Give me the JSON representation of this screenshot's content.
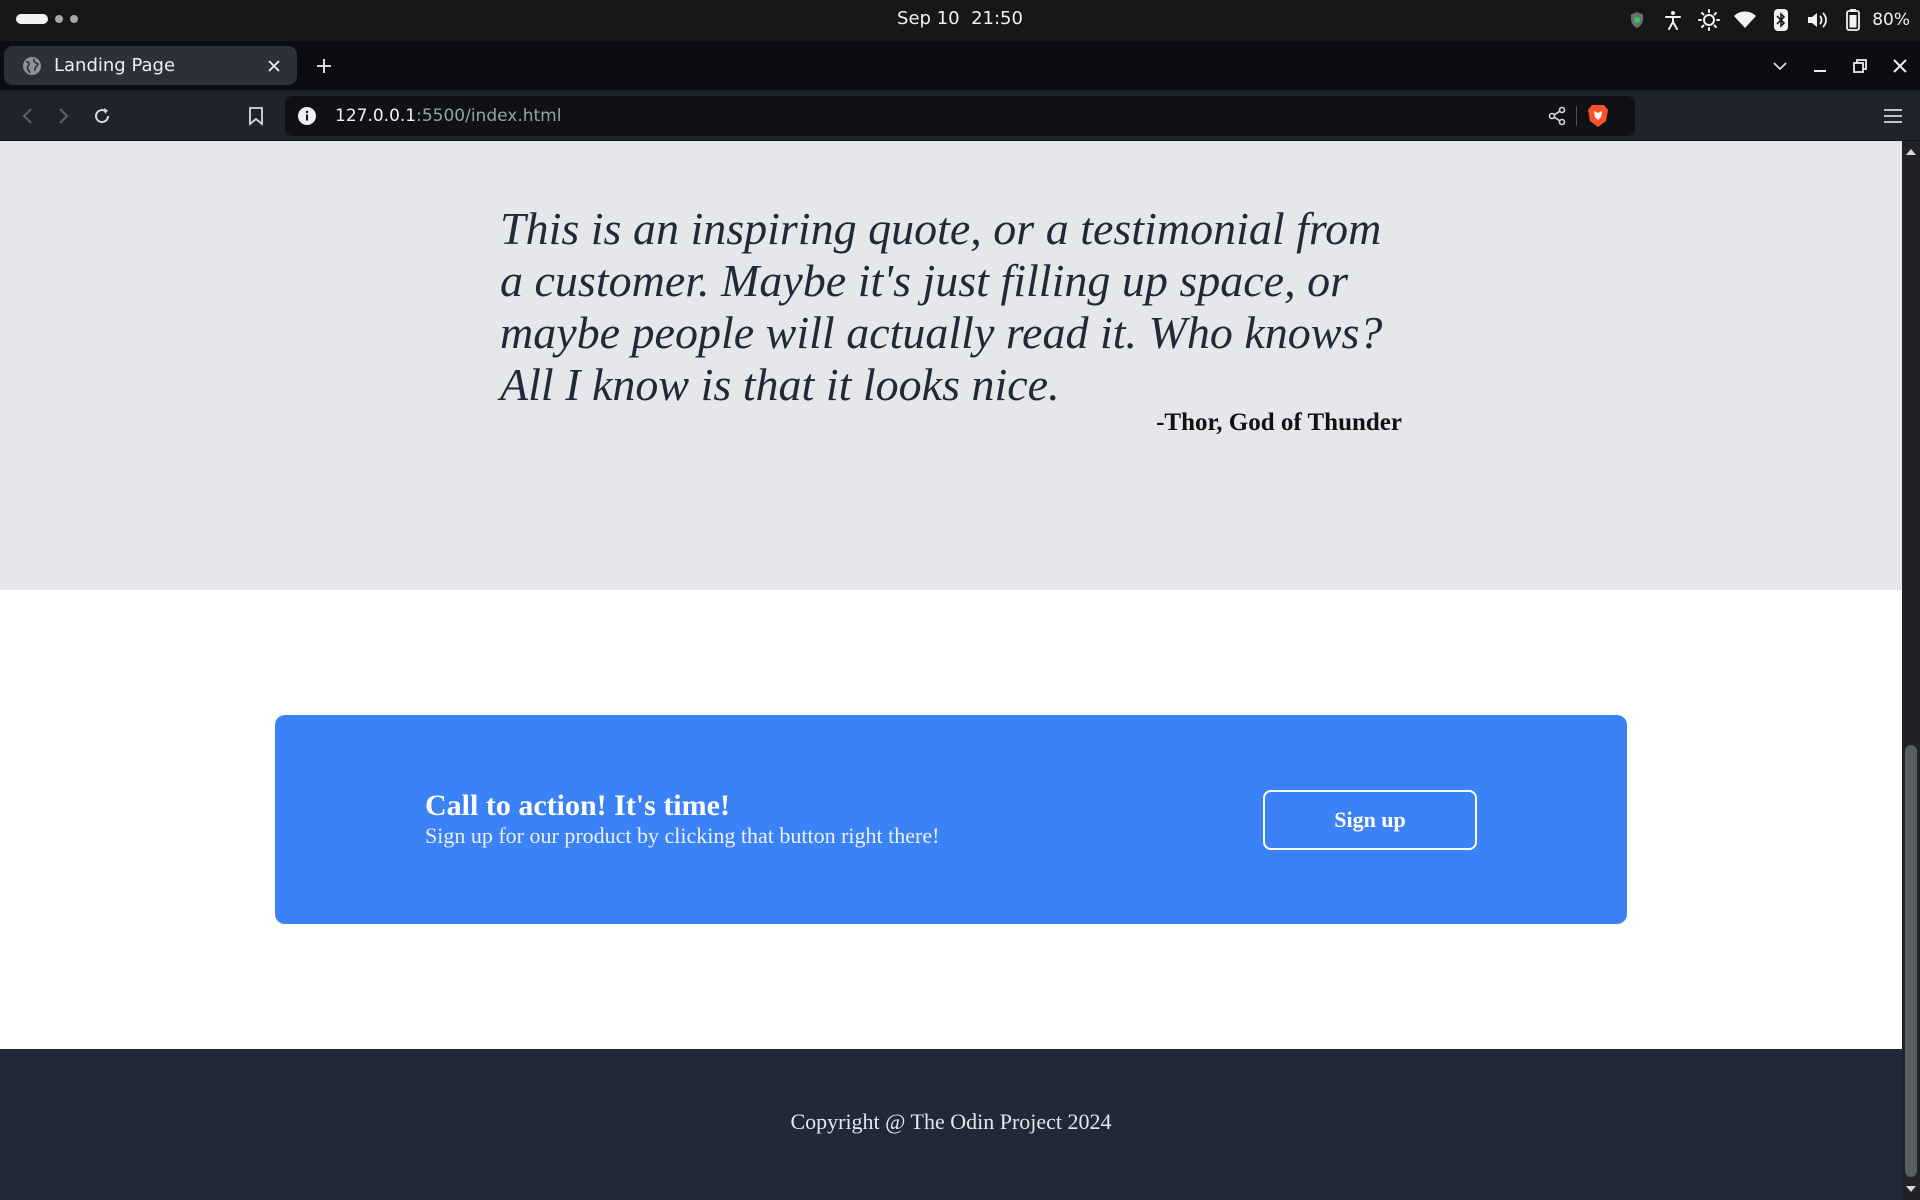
{
  "os": {
    "date": "Sep 10",
    "time": "21:50",
    "battery_percent": "80%",
    "tray_icons": [
      "shield-icon",
      "accessibility-icon",
      "brightness-icon",
      "wifi-icon",
      "bluetooth-icon",
      "volume-icon",
      "battery-icon"
    ]
  },
  "browser": {
    "tab_title": "Landing Page",
    "url_host": "127.0.0.1",
    "url_rest": ":5500/index.html",
    "accent_brave": "#fb542b"
  },
  "page": {
    "quote": {
      "text": "This is an inspiring quote, or a testimonial from a customer. Maybe it's just filling up space, or maybe people will actually read it. Who knows? All I know is that it looks nice.",
      "author": "-Thor, God of Thunder"
    },
    "cta": {
      "title": "Call to action! It's time!",
      "subtitle": "Sign up for our product by clicking that button right there!",
      "button_label": "Sign up",
      "background": "#3b82f6"
    },
    "footer": {
      "text": "Copyright @ The Odin Project 2024",
      "background": "#1f2937"
    },
    "quote_background": "#e5e7eb"
  }
}
